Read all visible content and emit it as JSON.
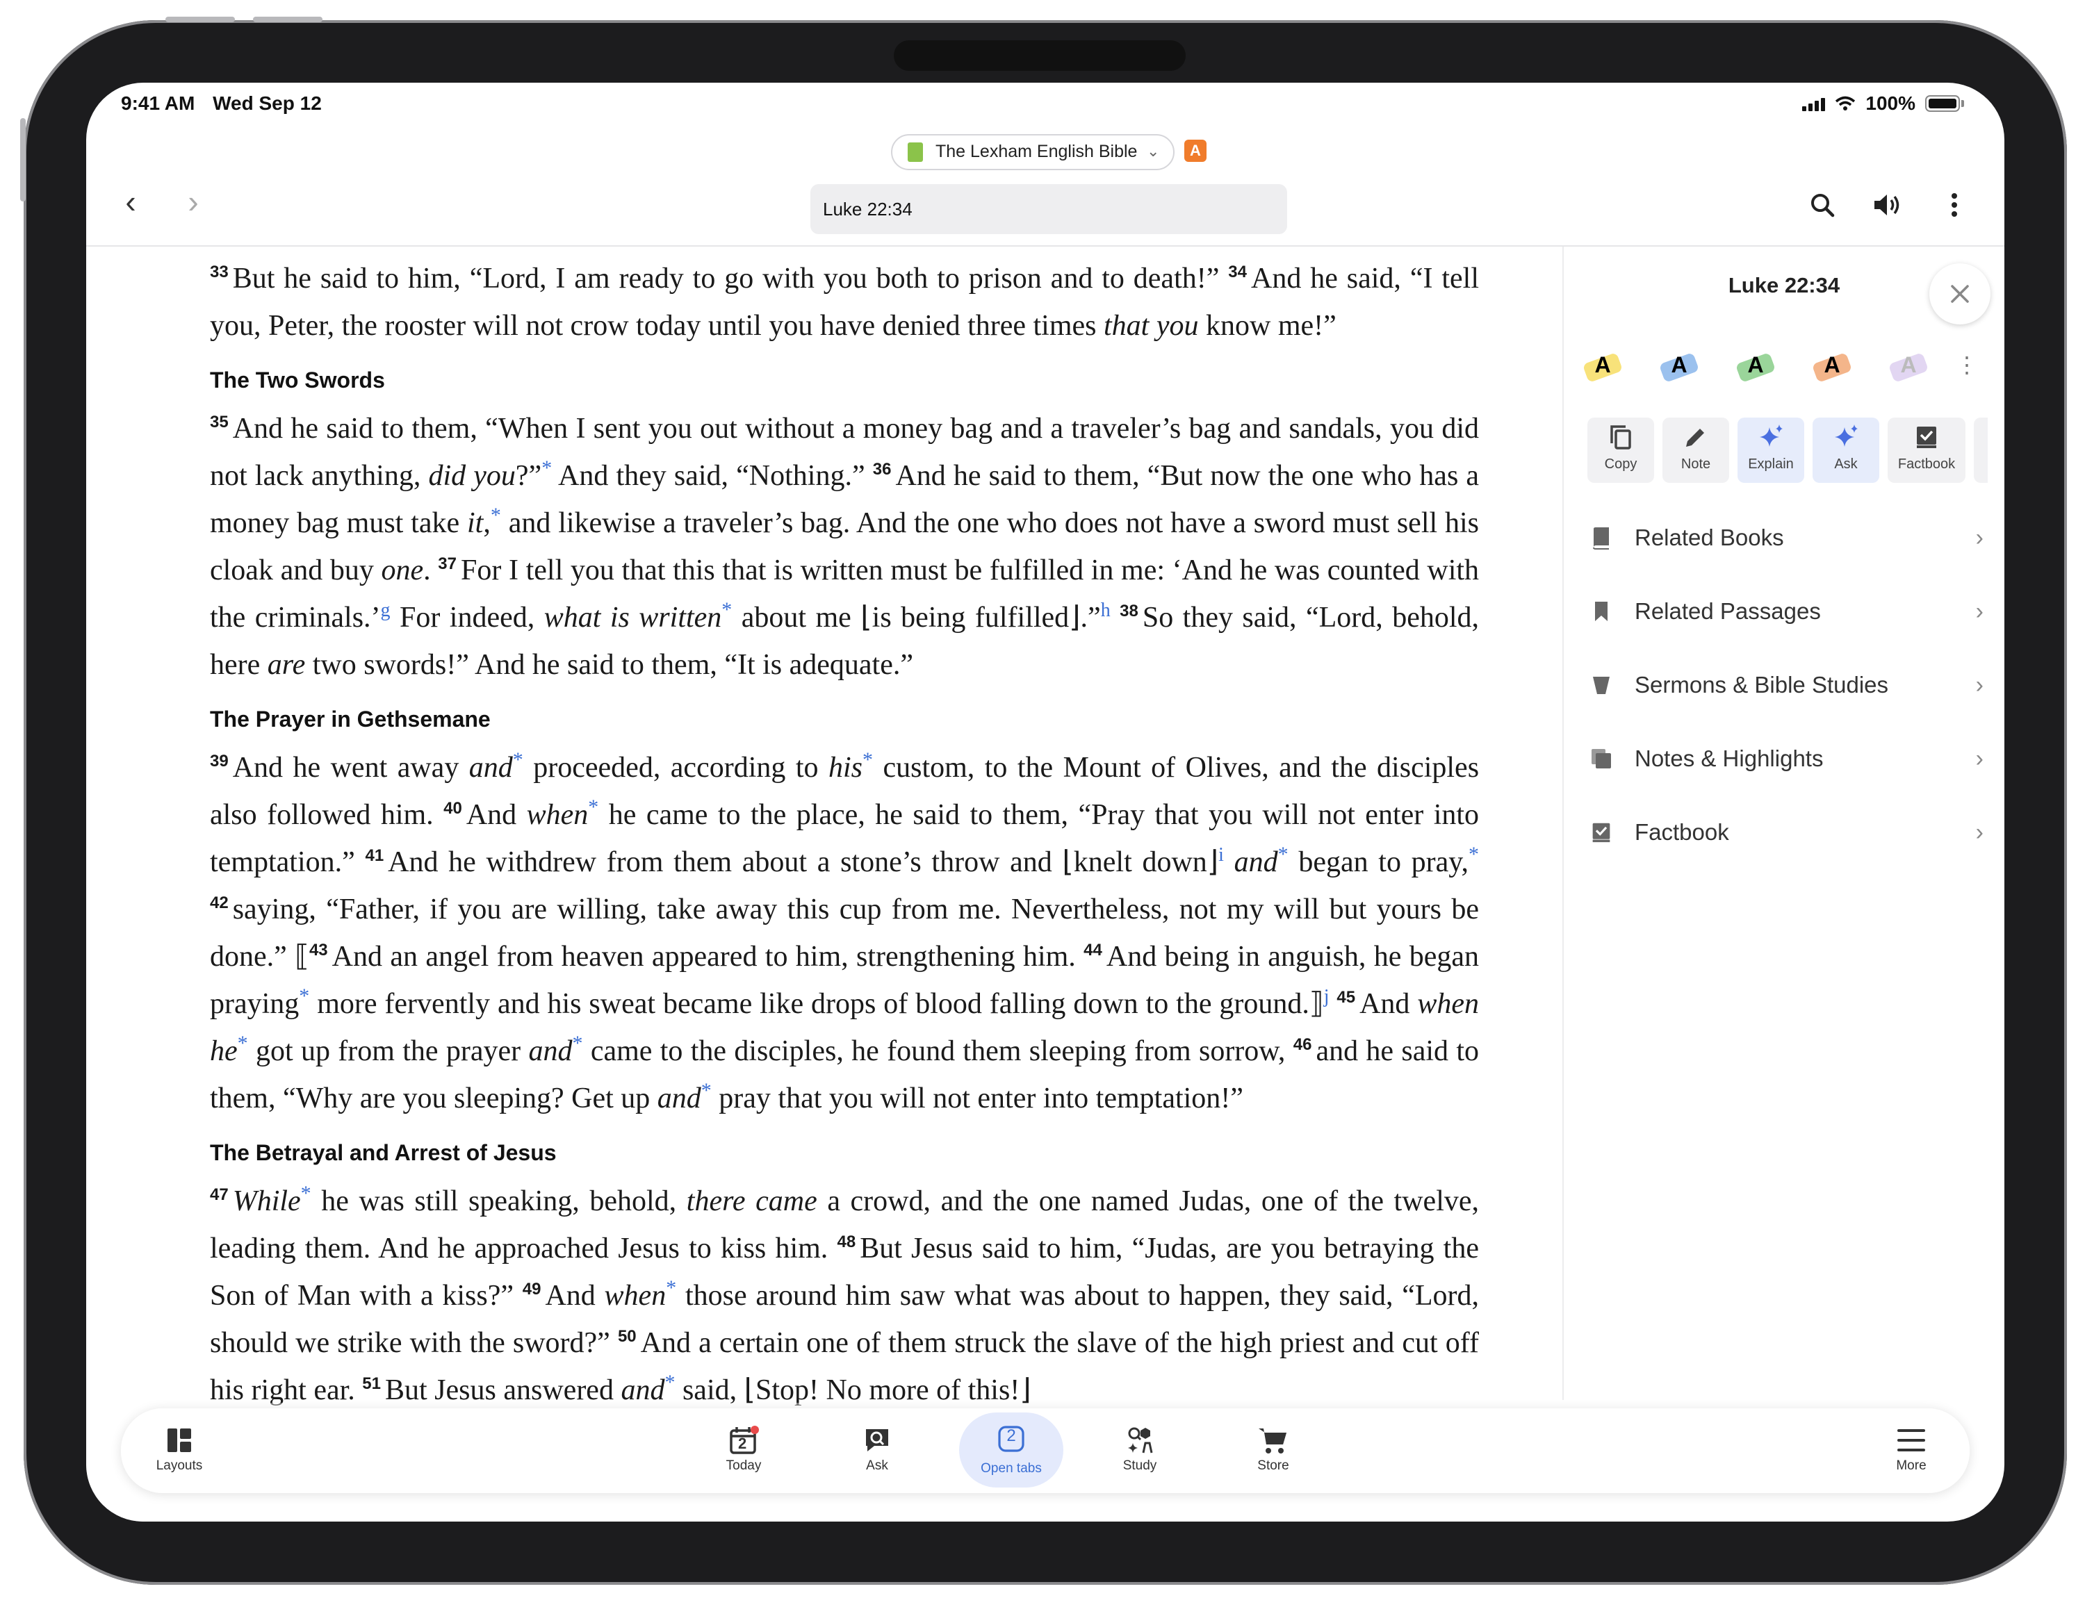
{
  "status_bar": {
    "time": "9:41 AM",
    "date": "Wed Sep 12",
    "battery": "100%"
  },
  "header": {
    "resource_name": "The Lexham English Bible",
    "resource_badge": "A",
    "reference": "Luke 22:34",
    "icons": [
      "back-icon",
      "forward-icon",
      "search-icon",
      "speaker-icon",
      "more-vertical-icon"
    ]
  },
  "panel": {
    "title": "Luke 22:34",
    "highlights": [
      "A",
      "A",
      "A",
      "A",
      "A"
    ],
    "actions": [
      {
        "label": "Copy",
        "icon": "copy-icon"
      },
      {
        "label": "Note",
        "icon": "pencil-icon"
      },
      {
        "label": "Explain",
        "icon": "sparkle-icon"
      },
      {
        "label": "Ask",
        "icon": "sparkle-icon"
      },
      {
        "label": "Factbook",
        "icon": "factbook-icon"
      }
    ],
    "menu": [
      {
        "label": "Related Books",
        "icon": "book-icon"
      },
      {
        "label": "Related Passages",
        "icon": "bookmark-icon"
      },
      {
        "label": "Sermons & Bible Studies",
        "icon": "podium-icon"
      },
      {
        "label": "Notes & Highlights",
        "icon": "notes-icon"
      },
      {
        "label": "Factbook",
        "icon": "factbook-icon"
      }
    ]
  },
  "tabbar": {
    "items": [
      {
        "label": "Layouts",
        "icon": "layouts-icon"
      },
      {
        "label": "Today",
        "icon": "calendar-icon",
        "day": "2"
      },
      {
        "label": "Ask",
        "icon": "ask-icon"
      },
      {
        "label": "Open tabs",
        "icon": "tabs-icon",
        "count": "2"
      },
      {
        "label": "Study",
        "icon": "study-icon"
      },
      {
        "label": "Store",
        "icon": "cart-icon"
      },
      {
        "label": "More",
        "icon": "menu-icon"
      }
    ]
  },
  "headings": [
    "The Two Swords",
    "The Prayer in Gethsemane",
    "The Betrayal and Arrest of Jesus"
  ],
  "verses": {
    "v33": "33",
    "t33": "But he said to him, “Lord, I am ready to go with you both to prison and to death!”",
    "v34": "34",
    "t34a": "And he said, “I tell you, Peter, the rooster will not crow today until you have denied three times",
    "t34i": "that you",
    "t34b": "know me!”",
    "v35": "35",
    "t35a": "And he said to them, “When I sent you out without a money bag and a traveler’s bag and sandals, you did not lack anything,",
    "t35i": "did you",
    "t35b": "?”",
    "t35c": "And they said, “Nothing.”",
    "v36": "36",
    "t36a": "And he said to them, “But now the one who has a money bag must take",
    "t36i": "it",
    "t36b": ",",
    "t36c": "and likewise a traveler’s bag. And the one who does not have a sword must sell his cloak and buy",
    "t36i2": "one",
    "t36d": ".",
    "v37": "37",
    "t37a": "For I tell you that this that is written must be fulfilled in me: ‘And he was counted with the criminals.’",
    "fn_g": "g",
    "t37b": "For indeed,",
    "t37i": "what is written",
    "t37c": "about me ⌊is being fulfilled⌋.”",
    "fn_h": "h",
    "v38": "38",
    "t38a": "So they said, “Lord, behold, here",
    "t38i": "are",
    "t38b": "two swords!” And he said to them, “It is adequate.”",
    "v39": "39",
    "t39a": "And he went away",
    "t39i": "and",
    "t39b": "proceeded, according to",
    "t39i2": "his",
    "t39c": "custom, to the Mount of Olives, and the disciples also followed him.",
    "v40": "40",
    "t40a": "And",
    "t40i": "when",
    "t40b": "he came to the place, he said to them, “Pray that you will not enter into temptation.”",
    "v41": "41",
    "t41a": "And he withdrew from them about a stone’s throw and ⌊knelt down⌋",
    "fn_i": "i",
    "t41i": "and",
    "t41b": "began to pray,",
    "v42": "42",
    "t42": "saying, “Father, if you are willing, take away this cup from me. Nevertheless, not my will but yours be done.” ⟦",
    "v43": "43",
    "t43": "And an angel from heaven appeared to him, strengthening him.",
    "v44": "44",
    "t44a": "And being in anguish, he began praying",
    "t44b": "more fervently and his sweat became like drops of blood falling down to the ground.⟧",
    "fn_j": "j",
    "v45": "45",
    "t45a": "And",
    "t45i": "when he",
    "t45b": "got up from the prayer",
    "t45i2": "and",
    "t45c": "came to the disciples, he found them sleeping from sorrow,",
    "v46": "46",
    "t46a": "and he said to them, “Why are you sleeping? Get up",
    "t46i": "and",
    "t46b": "pray that you will not enter into temptation!”",
    "v47": "47",
    "t47i": "While",
    "t47a": "he was still speaking, behold,",
    "t47i2": "there came",
    "t47b": "a crowd, and the one named Judas, one of the twelve, leading them. And he approached Jesus to kiss him.",
    "v48": "48",
    "t48": "But Jesus said to him, “Judas, are you betraying the Son of Man with a kiss?”",
    "v49": "49",
    "t49a": "And",
    "t49i": "when",
    "t49b": "those around him saw what was about to happen, they said, “Lord, should we strike with the sword?”",
    "v50": "50",
    "t50": "And a certain one of them struck the slave of the high priest and cut off his right ear.",
    "v51": "51",
    "t51a": "But Jesus answered",
    "t51i": "and",
    "t51b": "said, ⌊Stop! No more of this!⌋",
    "star": "*"
  }
}
